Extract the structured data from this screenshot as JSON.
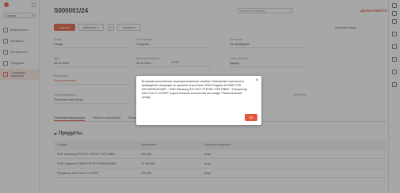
{
  "sidebar": {
    "warehouse_select": "Склады",
    "items": [
      {
        "label": "Витринность"
      },
      {
        "label": "Контакты"
      },
      {
        "label": "Контрагенты"
      },
      {
        "label": "Продукты"
      },
      {
        "label": "Складские операции"
      }
    ]
  },
  "header": {
    "title": "S000001/24",
    "command_placeholder": "Выполнить команду",
    "brand": "ДЕЛЬТАПЕРСИ"
  },
  "toolbar": {
    "close_label": "Закрыть",
    "actions_label": "Действия",
    "process_label": "Провести",
    "settings_label": "Настройка вида"
  },
  "form": {
    "warehouse_label": "Склад",
    "warehouse_value": "Склад",
    "operation_type_label": "Тип операции",
    "operation_type_value": "Отгрузка",
    "status_label": "Состояние",
    "status_value": "Не проведена",
    "date_label": "Дата",
    "date_value": "28.10.2024",
    "planned_date_label": "Дата планирования",
    "planned_date_value": "05.11.2024",
    "planned_time_value": "17:00",
    "responsible_label": "Ответственный",
    "responsible_value": "Курьер",
    "recipient_label": "Получатель",
    "recipient_value": "Ваша компания",
    "source_label": "Склад отправитель",
    "source_value": "Региональный склад",
    "dest_label": "Учёт/Место"
  },
  "tabs": [
    "Основная информация",
    "Файлы и примечания",
    "Вложения"
  ],
  "products": {
    "section_title": "Продукты",
    "columns": [
      "Продукт",
      "Количество",
      "Единица измерения"
    ],
    "rows": [
      {
        "product": "SSD Samsung 870 EVO 2TB MZ-77E2T0BW",
        "qty": "100,000",
        "unit": "штук"
      },
      {
        "product": "SSD Kingston KC3000 2TB SKC3000D/2048G",
        "qty": "12 000,000",
        "unit": "штук"
      },
      {
        "product": "Процессор Intel Core i7-12700F",
        "qty": "100,000",
        "unit": "штук"
      }
    ]
  },
  "dialog": {
    "message": "Во время выполнения операции возникли ошибки: Невозможно выполнить проведение операции по причине отсутствия \"SSD Kingston KC3000 2TB SKC3000D/2048G\", \"SSD Samsung 870 EVO 2TB MZ-77E2T0BW\", \"Процессор Intel Core i7-12700F\" в достаточном количестве на складе \"Региональный склад\".",
    "close_glyph": "×",
    "ok_label": "ОК"
  }
}
